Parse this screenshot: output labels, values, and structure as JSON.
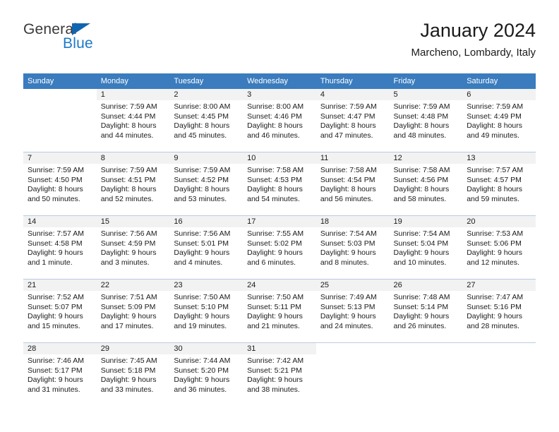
{
  "brand": {
    "name_part1": "General",
    "name_part2": "Blue",
    "accent_color": "#1C79C8",
    "triangle_color": "#1165B0"
  },
  "header": {
    "title": "January 2024",
    "subtitle": "Marcheno, Lombardy, Italy"
  },
  "calendar": {
    "header_bg": "#3A7CBE",
    "daynum_bg": "#F2F2F2",
    "weekdays": [
      "Sunday",
      "Monday",
      "Tuesday",
      "Wednesday",
      "Thursday",
      "Friday",
      "Saturday"
    ],
    "weeks": [
      [
        {
          "day": "",
          "sunrise": "",
          "sunset": "",
          "daylight_1": "",
          "daylight_2": ""
        },
        {
          "day": "1",
          "sunrise": "Sunrise: 7:59 AM",
          "sunset": "Sunset: 4:44 PM",
          "daylight_1": "Daylight: 8 hours",
          "daylight_2": "and 44 minutes."
        },
        {
          "day": "2",
          "sunrise": "Sunrise: 8:00 AM",
          "sunset": "Sunset: 4:45 PM",
          "daylight_1": "Daylight: 8 hours",
          "daylight_2": "and 45 minutes."
        },
        {
          "day": "3",
          "sunrise": "Sunrise: 8:00 AM",
          "sunset": "Sunset: 4:46 PM",
          "daylight_1": "Daylight: 8 hours",
          "daylight_2": "and 46 minutes."
        },
        {
          "day": "4",
          "sunrise": "Sunrise: 7:59 AM",
          "sunset": "Sunset: 4:47 PM",
          "daylight_1": "Daylight: 8 hours",
          "daylight_2": "and 47 minutes."
        },
        {
          "day": "5",
          "sunrise": "Sunrise: 7:59 AM",
          "sunset": "Sunset: 4:48 PM",
          "daylight_1": "Daylight: 8 hours",
          "daylight_2": "and 48 minutes."
        },
        {
          "day": "6",
          "sunrise": "Sunrise: 7:59 AM",
          "sunset": "Sunset: 4:49 PM",
          "daylight_1": "Daylight: 8 hours",
          "daylight_2": "and 49 minutes."
        }
      ],
      [
        {
          "day": "7",
          "sunrise": "Sunrise: 7:59 AM",
          "sunset": "Sunset: 4:50 PM",
          "daylight_1": "Daylight: 8 hours",
          "daylight_2": "and 50 minutes."
        },
        {
          "day": "8",
          "sunrise": "Sunrise: 7:59 AM",
          "sunset": "Sunset: 4:51 PM",
          "daylight_1": "Daylight: 8 hours",
          "daylight_2": "and 52 minutes."
        },
        {
          "day": "9",
          "sunrise": "Sunrise: 7:59 AM",
          "sunset": "Sunset: 4:52 PM",
          "daylight_1": "Daylight: 8 hours",
          "daylight_2": "and 53 minutes."
        },
        {
          "day": "10",
          "sunrise": "Sunrise: 7:58 AM",
          "sunset": "Sunset: 4:53 PM",
          "daylight_1": "Daylight: 8 hours",
          "daylight_2": "and 54 minutes."
        },
        {
          "day": "11",
          "sunrise": "Sunrise: 7:58 AM",
          "sunset": "Sunset: 4:54 PM",
          "daylight_1": "Daylight: 8 hours",
          "daylight_2": "and 56 minutes."
        },
        {
          "day": "12",
          "sunrise": "Sunrise: 7:58 AM",
          "sunset": "Sunset: 4:56 PM",
          "daylight_1": "Daylight: 8 hours",
          "daylight_2": "and 58 minutes."
        },
        {
          "day": "13",
          "sunrise": "Sunrise: 7:57 AM",
          "sunset": "Sunset: 4:57 PM",
          "daylight_1": "Daylight: 8 hours",
          "daylight_2": "and 59 minutes."
        }
      ],
      [
        {
          "day": "14",
          "sunrise": "Sunrise: 7:57 AM",
          "sunset": "Sunset: 4:58 PM",
          "daylight_1": "Daylight: 9 hours",
          "daylight_2": "and 1 minute."
        },
        {
          "day": "15",
          "sunrise": "Sunrise: 7:56 AM",
          "sunset": "Sunset: 4:59 PM",
          "daylight_1": "Daylight: 9 hours",
          "daylight_2": "and 3 minutes."
        },
        {
          "day": "16",
          "sunrise": "Sunrise: 7:56 AM",
          "sunset": "Sunset: 5:01 PM",
          "daylight_1": "Daylight: 9 hours",
          "daylight_2": "and 4 minutes."
        },
        {
          "day": "17",
          "sunrise": "Sunrise: 7:55 AM",
          "sunset": "Sunset: 5:02 PM",
          "daylight_1": "Daylight: 9 hours",
          "daylight_2": "and 6 minutes."
        },
        {
          "day": "18",
          "sunrise": "Sunrise: 7:54 AM",
          "sunset": "Sunset: 5:03 PM",
          "daylight_1": "Daylight: 9 hours",
          "daylight_2": "and 8 minutes."
        },
        {
          "day": "19",
          "sunrise": "Sunrise: 7:54 AM",
          "sunset": "Sunset: 5:04 PM",
          "daylight_1": "Daylight: 9 hours",
          "daylight_2": "and 10 minutes."
        },
        {
          "day": "20",
          "sunrise": "Sunrise: 7:53 AM",
          "sunset": "Sunset: 5:06 PM",
          "daylight_1": "Daylight: 9 hours",
          "daylight_2": "and 12 minutes."
        }
      ],
      [
        {
          "day": "21",
          "sunrise": "Sunrise: 7:52 AM",
          "sunset": "Sunset: 5:07 PM",
          "daylight_1": "Daylight: 9 hours",
          "daylight_2": "and 15 minutes."
        },
        {
          "day": "22",
          "sunrise": "Sunrise: 7:51 AM",
          "sunset": "Sunset: 5:09 PM",
          "daylight_1": "Daylight: 9 hours",
          "daylight_2": "and 17 minutes."
        },
        {
          "day": "23",
          "sunrise": "Sunrise: 7:50 AM",
          "sunset": "Sunset: 5:10 PM",
          "daylight_1": "Daylight: 9 hours",
          "daylight_2": "and 19 minutes."
        },
        {
          "day": "24",
          "sunrise": "Sunrise: 7:50 AM",
          "sunset": "Sunset: 5:11 PM",
          "daylight_1": "Daylight: 9 hours",
          "daylight_2": "and 21 minutes."
        },
        {
          "day": "25",
          "sunrise": "Sunrise: 7:49 AM",
          "sunset": "Sunset: 5:13 PM",
          "daylight_1": "Daylight: 9 hours",
          "daylight_2": "and 24 minutes."
        },
        {
          "day": "26",
          "sunrise": "Sunrise: 7:48 AM",
          "sunset": "Sunset: 5:14 PM",
          "daylight_1": "Daylight: 9 hours",
          "daylight_2": "and 26 minutes."
        },
        {
          "day": "27",
          "sunrise": "Sunrise: 7:47 AM",
          "sunset": "Sunset: 5:16 PM",
          "daylight_1": "Daylight: 9 hours",
          "daylight_2": "and 28 minutes."
        }
      ],
      [
        {
          "day": "28",
          "sunrise": "Sunrise: 7:46 AM",
          "sunset": "Sunset: 5:17 PM",
          "daylight_1": "Daylight: 9 hours",
          "daylight_2": "and 31 minutes."
        },
        {
          "day": "29",
          "sunrise": "Sunrise: 7:45 AM",
          "sunset": "Sunset: 5:18 PM",
          "daylight_1": "Daylight: 9 hours",
          "daylight_2": "and 33 minutes."
        },
        {
          "day": "30",
          "sunrise": "Sunrise: 7:44 AM",
          "sunset": "Sunset: 5:20 PM",
          "daylight_1": "Daylight: 9 hours",
          "daylight_2": "and 36 minutes."
        },
        {
          "day": "31",
          "sunrise": "Sunrise: 7:42 AM",
          "sunset": "Sunset: 5:21 PM",
          "daylight_1": "Daylight: 9 hours",
          "daylight_2": "and 38 minutes."
        },
        {
          "day": "",
          "sunrise": "",
          "sunset": "",
          "daylight_1": "",
          "daylight_2": ""
        },
        {
          "day": "",
          "sunrise": "",
          "sunset": "",
          "daylight_1": "",
          "daylight_2": ""
        },
        {
          "day": "",
          "sunrise": "",
          "sunset": "",
          "daylight_1": "",
          "daylight_2": ""
        }
      ]
    ]
  }
}
